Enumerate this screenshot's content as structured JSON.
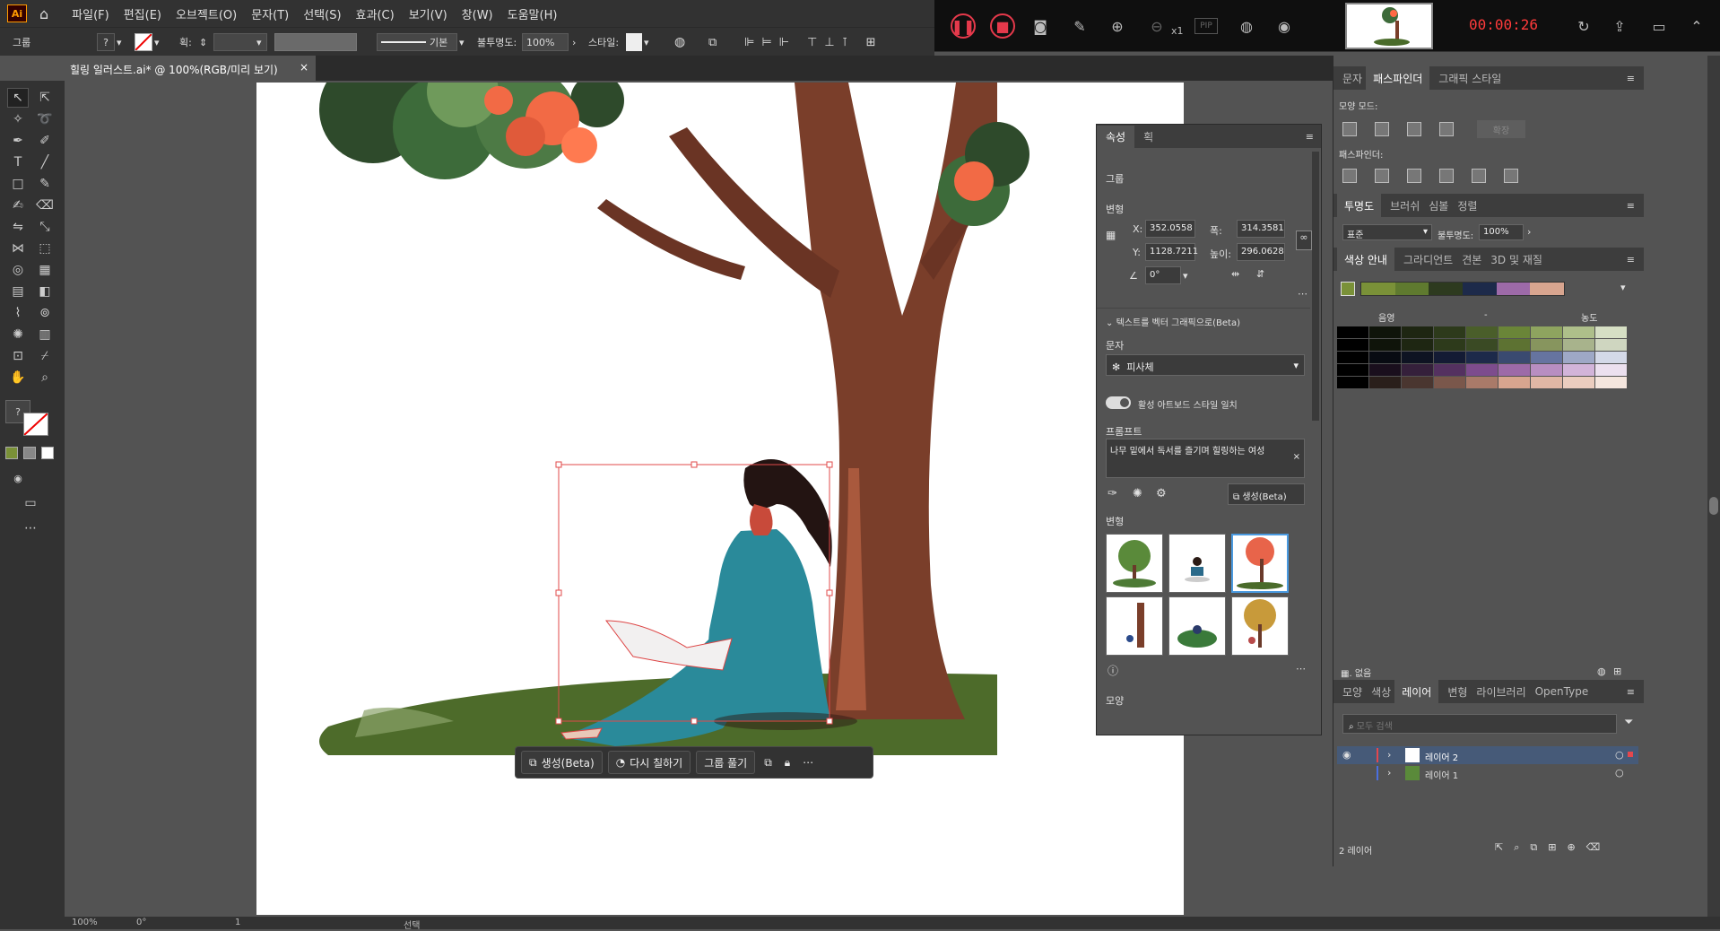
{
  "app": {
    "logo": "Ai",
    "document_tab": "힐링 일러스트.ai* @ 100%(RGB/미리 보기)"
  },
  "menu": [
    "파일(F)",
    "편집(E)",
    "오브젝트(O)",
    "문자(T)",
    "선택(S)",
    "효과(C)",
    "보기(V)",
    "창(W)",
    "도움말(H)"
  ],
  "recorder": {
    "zoom_suffix": "x1",
    "pip": "PIP",
    "time": "00:00:26"
  },
  "control": {
    "selection_type": "그룹",
    "stroke_label": "획:",
    "brush": "기본",
    "opacity_label": "불투명도:",
    "opacity": "100%",
    "style_label": "스타일:"
  },
  "taskbar": {
    "generate": "생성(Beta)",
    "recolor": "다시 칠하기",
    "ungroup": "그룹 풀기"
  },
  "status": {
    "zoom": "100%",
    "rotation": "0°",
    "page": "1",
    "tool": "선택"
  },
  "properties": {
    "tabs": [
      "속성",
      "획"
    ],
    "section_group": "그룹",
    "section_transform": "변형",
    "x_label": "X:",
    "x": "352.0558",
    "y_label": "Y:",
    "y": "1128.7211",
    "w_label": "폭:",
    "w": "314.3581",
    "h_label": "높이:",
    "h": "296.0628",
    "angle": "0°",
    "text_to_vector": "텍스트를 벡터 그래픽으로(Beta)",
    "type_label": "문자",
    "type_value": "피사체",
    "match_style": "활성 아트보드 스타일 일치",
    "prompt_label": "프롬프트",
    "prompt": "나무 밑에서 독서를 즐기며 힐링하는 여성",
    "generate": "생성(Beta)",
    "variations_label": "변형",
    "shape_label": "모양"
  },
  "pathfinder": {
    "tabs": [
      "문자",
      "패스파인더",
      "그래픽 스타일"
    ],
    "shape_modes": "모양 모드:",
    "expand": "확장",
    "pathfinders": "패스파인더:"
  },
  "transparency": {
    "tabs": [
      "투명도",
      "브러쉬",
      "심볼",
      "정렬"
    ],
    "blend": "표준",
    "opacity_label": "불투명도:",
    "opacity": "100%"
  },
  "color_guide": {
    "tabs": [
      "색상 안내",
      "그라디언트",
      "견본",
      "3D 및 재질"
    ],
    "tints": "음영",
    "tones": "농도",
    "status": "없음",
    "swatches": [
      "#7a9138",
      "#5f7a2f",
      "#2d3a1f",
      "#1d2a4a",
      "#9d6aa8",
      "#d8a58f"
    ],
    "grid": [
      [
        "#000000",
        "#0f140a",
        "#1e2612",
        "#2d3a1b",
        "#4a5e2a",
        "#6a8538",
        "#8ea45f",
        "#aebf8a",
        "#d6dfc4"
      ],
      [
        "#000000",
        "#0f140a",
        "#1e2612",
        "#2d3a1b",
        "#3a4a24",
        "#5d7232",
        "#87955e",
        "#a8b38c",
        "#cfd6c0"
      ],
      [
        "#000000",
        "#080b12",
        "#0e1322",
        "#141b34",
        "#1d2a4a",
        "#3a4a70",
        "#6674a0",
        "#9ea8c6",
        "#d4d9e8"
      ],
      [
        "#000000",
        "#1a0f1d",
        "#35203b",
        "#543160",
        "#7d4c8d",
        "#9d6aa8",
        "#b88ec1",
        "#d2b4d9",
        "#ece0ef"
      ],
      [
        "#000000",
        "#2a1f1b",
        "#4a3630",
        "#7a574b",
        "#a97a69",
        "#d8a58f",
        "#e1b7a5",
        "#ebcdbf",
        "#f5e6de"
      ]
    ]
  },
  "layers": {
    "tabs": [
      "모양",
      "색상",
      "레이어",
      "변형",
      "라이브러리",
      "OpenType"
    ],
    "search_placeholder": "모두 검색",
    "items": [
      "레이어 2",
      "레이어 1"
    ],
    "count": "2 레이어",
    "colors": {
      "layer2": "#e4474d",
      "layer1": "#4a6fe0"
    }
  }
}
